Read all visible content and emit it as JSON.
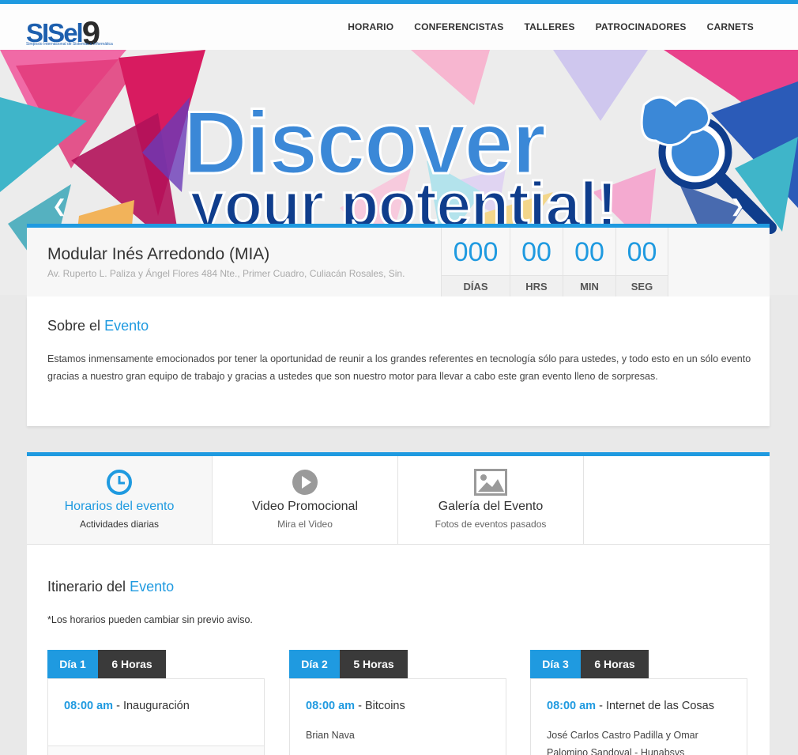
{
  "header": {
    "logo_text": "SISel9",
    "logo_main": "SISel",
    "logo_num": "9",
    "logo_tagline": "Simposio Internacional de Sistemas e Informática",
    "nav": [
      "HORARIO",
      "CONFERENCISTAS",
      "TALLERES",
      "PATROCINADORES",
      "CARNETS"
    ]
  },
  "hero": {
    "line1": "Discover",
    "line2": "your potential!",
    "prev_icon": "chevron-left-icon",
    "next_icon": "chevron-right-icon"
  },
  "venue": {
    "name": "Modular Inés Arredondo (MIA)",
    "address": "Av. Ruperto L. Paliza y Ángel Flores 484 Nte., Primer Cuadro, Culiacán Rosales, Sin."
  },
  "countdown": [
    {
      "value": "000",
      "label": "DÍAS"
    },
    {
      "value": "00",
      "label": "HRS"
    },
    {
      "value": "00",
      "label": "MIN"
    },
    {
      "value": "00",
      "label": "SEG"
    }
  ],
  "about": {
    "title_prefix": "Sobre el",
    "title_accent": "Evento",
    "text": "Estamos inmensamente emocionados por tener la oportunidad de reunir a los grandes referentes en tecnología sólo para ustedes, y todo esto en un sólo evento gracias a nuestro gran equipo de trabajo y gracias a ustedes que son nuestro motor para llevar a cabo este gran evento lleno de sorpresas."
  },
  "tabs": [
    {
      "title": "Horarios del evento",
      "subtitle": "Actividades diarias",
      "icon": "clock-icon",
      "active": true
    },
    {
      "title": "Video Promocional",
      "subtitle": "Mira el Video",
      "icon": "play-icon",
      "active": false
    },
    {
      "title": "Galería del Evento",
      "subtitle": "Fotos de eventos pasados",
      "icon": "image-icon",
      "active": false
    }
  ],
  "itinerary": {
    "title_prefix": "Itinerario del",
    "title_accent": "Evento",
    "note": "*Los horarios pueden cambiar sin previo aviso.",
    "days": [
      {
        "label": "Día 1",
        "hours": "6 Horas",
        "time": "08:00 am",
        "title": "Inauguración",
        "speaker": ""
      },
      {
        "label": "Día 2",
        "hours": "5 Horas",
        "time": "08:00 am",
        "title": "Bitcoins",
        "speaker": "Brian Nava"
      },
      {
        "label": "Día 3",
        "hours": "6 Horas",
        "time": "08:00 am",
        "title": "Internet de las Cosas",
        "speaker": "José Carlos Castro Padilla y Omar Palomino Sandoval - Hunabsys"
      }
    ]
  },
  "colors": {
    "accent": "#1f9ae0",
    "dark": "#3a3a3a",
    "hero_blue": "#3b88d7",
    "hero_navy": "#0f3d8c"
  }
}
